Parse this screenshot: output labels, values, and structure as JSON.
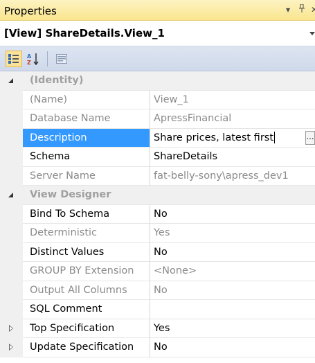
{
  "window": {
    "title": "Properties",
    "buttons": [
      "dropdown-icon",
      "pin-icon",
      "close-icon"
    ]
  },
  "selector": {
    "object": "[View] ShareDetails.View_1"
  },
  "toolbar": {
    "buttons": [
      "categorized-icon",
      "alphabetical-icon",
      "property-pages-icon"
    ],
    "active": "categorized-icon"
  },
  "grid": {
    "categories": [
      {
        "name": "(Identity)",
        "expanded": true,
        "properties": [
          {
            "name": "(Name)",
            "value": "View_1",
            "readonly": true
          },
          {
            "name": "Database Name",
            "value": "ApressFinancial",
            "readonly": true
          },
          {
            "name": "Description",
            "value": "Share prices, latest first",
            "readonly": false,
            "selected": true
          },
          {
            "name": "Schema",
            "value": "ShareDetails",
            "readonly": false
          },
          {
            "name": "Server Name",
            "value": "fat-belly-sony\\apress_dev1",
            "readonly": true
          }
        ]
      },
      {
        "name": "View Designer",
        "expanded": true,
        "properties": [
          {
            "name": "Bind To Schema",
            "value": "No",
            "readonly": false
          },
          {
            "name": "Deterministic",
            "value": "Yes",
            "readonly": true
          },
          {
            "name": "Distinct Values",
            "value": "No",
            "readonly": false
          },
          {
            "name": "GROUP BY Extension",
            "value": "<None>",
            "readonly": true
          },
          {
            "name": "Output All Columns",
            "value": "No",
            "readonly": true
          },
          {
            "name": "SQL Comment",
            "value": "",
            "readonly": false
          },
          {
            "name": "Top Specification",
            "value": "Yes",
            "readonly": false,
            "expandable": true
          },
          {
            "name": "Update Specification",
            "value": "No",
            "readonly": false,
            "expandable": true
          }
        ]
      }
    ]
  },
  "colors": {
    "titlebar": "#f9e58e",
    "selection": "#3399ff",
    "toolbar": "#cfd9ea",
    "readonly_text": "#8a8a8a",
    "category_text": "#a0a0a0"
  }
}
